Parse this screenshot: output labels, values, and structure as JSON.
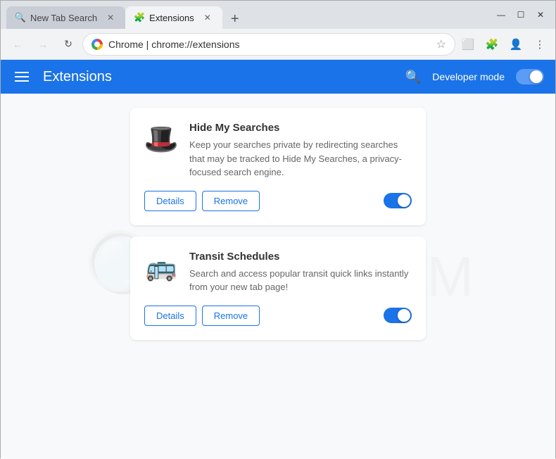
{
  "browser": {
    "tabs": [
      {
        "id": "new-tab-search",
        "label": "New Tab Search",
        "active": false,
        "icon": "🔍"
      },
      {
        "id": "extensions",
        "label": "Extensions",
        "active": true,
        "icon": "🧩"
      }
    ],
    "new_tab_btn": "+",
    "window_controls": {
      "minimize": "—",
      "maximize": "☐",
      "close": "✕"
    },
    "address_bar": {
      "domain": "Chrome",
      "separator": " | ",
      "url": "chrome://extensions",
      "favicon": "chrome"
    }
  },
  "extensions_header": {
    "title": "Extensions",
    "dev_mode_label": "Developer mode",
    "hamburger_aria": "Menu"
  },
  "extensions": [
    {
      "id": "hide-my-searches",
      "name": "Hide My Searches",
      "description": "Keep your searches private by redirecting searches that may be tracked to Hide My Searches, a privacy-focused search engine.",
      "icon": "🎩",
      "details_label": "Details",
      "remove_label": "Remove",
      "enabled": true
    },
    {
      "id": "transit-schedules",
      "name": "Transit Schedules",
      "description": "Search and access popular transit quick links instantly from your new tab page!",
      "icon": "🚌",
      "details_label": "Details",
      "remove_label": "Remove",
      "enabled": true
    }
  ],
  "watermark": {
    "text": "FISA.COM"
  }
}
